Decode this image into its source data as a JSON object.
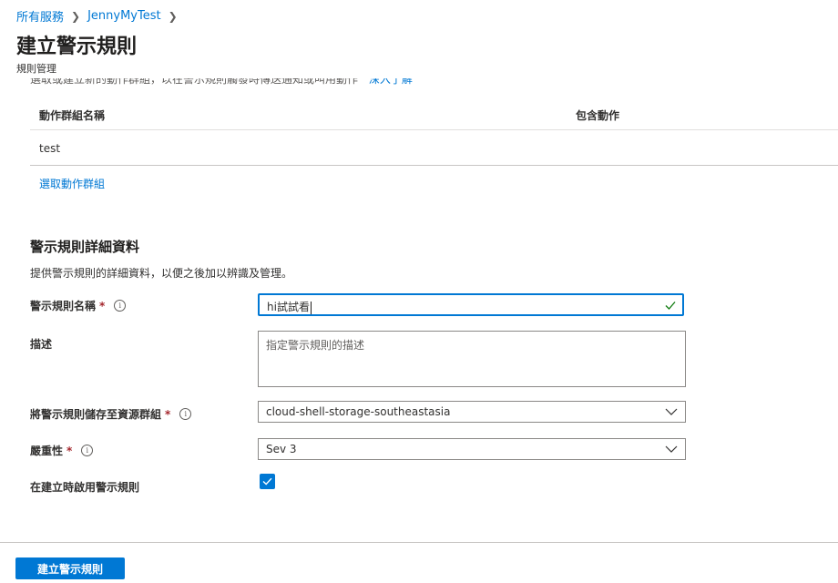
{
  "breadcrumb": {
    "items": [
      "所有服務",
      "JennyMyTest"
    ]
  },
  "header": {
    "title": "建立警示規則",
    "subtitle": "規則管理"
  },
  "action_groups": {
    "intro_text": "選取或建立新的動作群組，以在警示規則觸發時傳送通知或叫用動作",
    "intro_link": "深入了解",
    "columns": [
      "動作群組名稱",
      "包含動作"
    ],
    "rows": [
      {
        "name": "test",
        "actions": ""
      }
    ],
    "select_link": "選取動作群組"
  },
  "details": {
    "title": "警示規則詳細資料",
    "description": "提供警示規則的詳細資料，以便之後加以辨識及管理。",
    "rule_name_label": "警示規則名稱",
    "rule_name_value": "hi試試看",
    "description_label": "描述",
    "description_placeholder": "指定警示規則的描述",
    "resource_group_label": "將警示規則儲存至資源群組",
    "resource_group_value": "cloud-shell-storage-southeastasia",
    "severity_label": "嚴重性",
    "severity_value": "Sev 3",
    "enable_label": "在建立時啟用警示規則",
    "enable_checked": true,
    "required_mark": "*",
    "info_glyph": "i"
  },
  "footer": {
    "create_button": "建立警示規則"
  },
  "colors": {
    "accent": "#0078d4",
    "required": "#a4262c",
    "valid": "#107c10"
  }
}
